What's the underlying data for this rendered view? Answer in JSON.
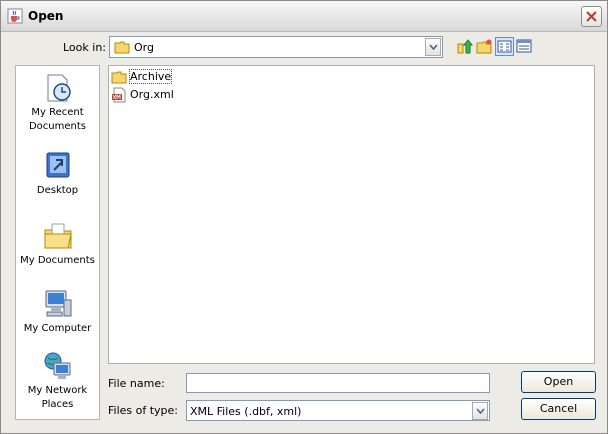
{
  "window": {
    "title": "Open",
    "title_icon": "java-cup-icon",
    "close_icon": "close-icon"
  },
  "lookin": {
    "label": "Look in:",
    "value": "Org",
    "folder_icon": "folder-icon"
  },
  "toolbar": {
    "icons": [
      "up-one-level-icon",
      "create-new-folder-icon",
      "list-view-icon",
      "details-view-icon"
    ],
    "selected": "list-view-icon"
  },
  "places": [
    {
      "label": "My Recent Documents",
      "icon": "recent-documents-icon"
    },
    {
      "label": "Desktop",
      "icon": "desktop-icon"
    },
    {
      "label": "My Documents",
      "icon": "my-documents-icon"
    },
    {
      "label": "My Computer",
      "icon": "my-computer-icon"
    },
    {
      "label": "My Network Places",
      "icon": "network-places-icon"
    }
  ],
  "files": [
    {
      "name": "Archive",
      "icon": "folder-icon"
    },
    {
      "name": "Org.xml",
      "icon": "xml-file-icon"
    }
  ],
  "filename": {
    "label": "File name:",
    "value": ""
  },
  "filetype": {
    "label": "Files of type:",
    "value": "XML Files (.dbf, xml)"
  },
  "buttons": {
    "open": "Open",
    "cancel": "Cancel"
  },
  "colors": {
    "dialog_bg": "#ecebe6",
    "field_border": "#7f9db9",
    "button_border": "#003c74",
    "folder_yellow": "#f5d76e"
  }
}
